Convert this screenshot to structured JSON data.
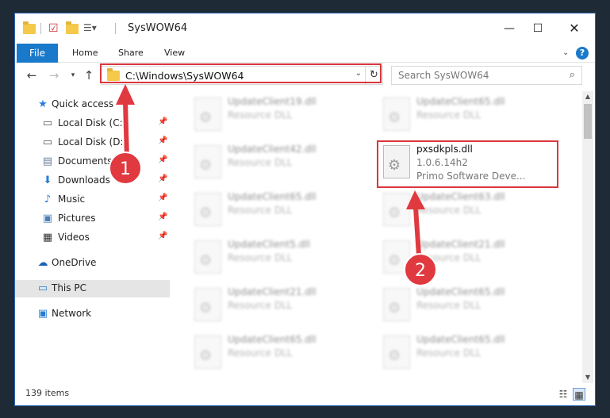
{
  "window": {
    "title": "SysWOW64"
  },
  "ribbon": {
    "tabs": [
      "File",
      "Home",
      "Share",
      "View"
    ]
  },
  "address": {
    "path": "C:\\Windows\\SysWOW64",
    "search_placeholder": "Search SysWOW64"
  },
  "sidebar": {
    "items": [
      {
        "label": "Quick access",
        "icon": "star-icon"
      },
      {
        "label": "Local Disk (C:)",
        "icon": "drive-icon",
        "pinned": true
      },
      {
        "label": "Local Disk (D:)",
        "icon": "drive-icon",
        "pinned": true
      },
      {
        "label": "Documents",
        "icon": "documents-icon",
        "pinned": true
      },
      {
        "label": "Downloads",
        "icon": "download-icon",
        "pinned": true
      },
      {
        "label": "Music",
        "icon": "music-icon",
        "pinned": true
      },
      {
        "label": "Pictures",
        "icon": "pictures-icon",
        "pinned": true
      },
      {
        "label": "Videos",
        "icon": "videos-icon",
        "pinned": true
      },
      {
        "label": "OneDrive",
        "icon": "onedrive-icon"
      },
      {
        "label": "This PC",
        "icon": "computer-icon",
        "selected": true
      },
      {
        "label": "Network",
        "icon": "network-icon"
      }
    ]
  },
  "files": [
    {
      "name": "UpdateClient19.dll",
      "desc": "Resource DLL"
    },
    {
      "name": "UpdateClient65.dll",
      "desc": "Resource DLL"
    },
    {
      "name": "UpdateClient42.dll",
      "desc": "Resource DLL"
    },
    {
      "name": "pxsdkpls.dll",
      "desc": "1.0.6.14h2",
      "publisher": "Primo Software Deve..."
    },
    {
      "name": "UpdateClient65.dll",
      "desc": "Resource DLL"
    },
    {
      "name": "UpdateClient63.dll",
      "desc": "Resource DLL"
    },
    {
      "name": "UpdateClient5.dll",
      "desc": "Resource DLL"
    },
    {
      "name": "UpdateClient21.dll",
      "desc": "Resource DLL"
    },
    {
      "name": "UpdateClient21.dll",
      "desc": "Resource DLL"
    },
    {
      "name": "UpdateClient65.dll",
      "desc": "Resource DLL"
    },
    {
      "name": "UpdateClient65.dll",
      "desc": "Resource DLL"
    },
    {
      "name": "UpdateClient65.dll",
      "desc": "Resource DLL"
    }
  ],
  "status": {
    "item_count": "139 items"
  },
  "annotations": {
    "step1": "1",
    "step2": "2",
    "color": "#e0393f"
  }
}
